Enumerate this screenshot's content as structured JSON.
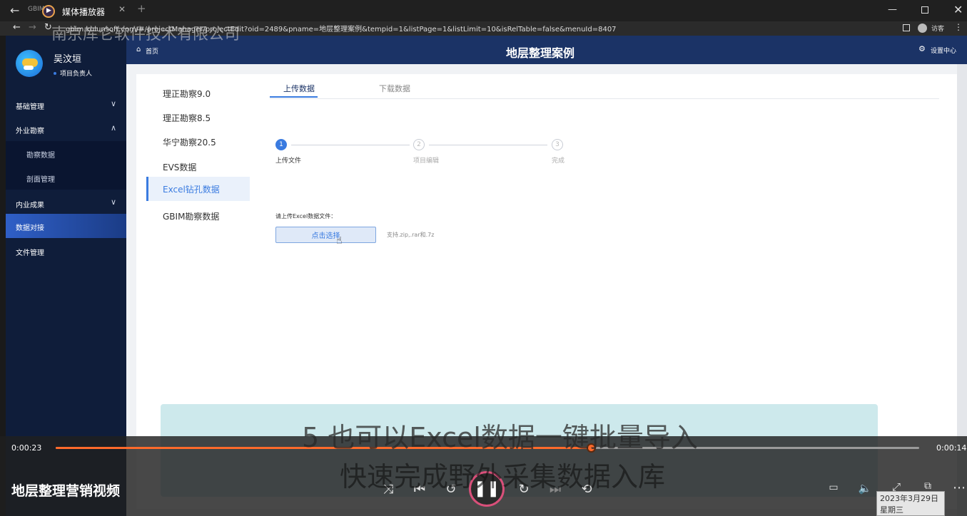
{
  "player": {
    "tab_title": "GBIM",
    "app_title": "媒体播放器",
    "time_current": "0:00:23",
    "time_remaining": "0:00:14",
    "progress": 0.62,
    "video_title": "地层整理营销视频"
  },
  "browser": {
    "url": "gbim.kulunsoft.com/#/projectManager/projectEdit?oid=2489&pname=地层整理案例&tempid=1&listPage=1&listLimit=10&isRelTable=false&menuId=8407",
    "user_label": "访客"
  },
  "watermark": "南京库仑软件技术有限公司",
  "user": {
    "name": "吴汶垣",
    "role": "项目负责人"
  },
  "sidebar": {
    "items": [
      {
        "label": "基础管理",
        "chevron": "∨"
      },
      {
        "label": "外业勘察",
        "chevron": "∧"
      },
      {
        "label": "勘察数据"
      },
      {
        "label": "剖面管理"
      },
      {
        "label": "内业成果",
        "chevron": "∨"
      },
      {
        "label": "数据对接"
      },
      {
        "label": "文件管理"
      }
    ]
  },
  "header": {
    "home": "首页",
    "title": "地层整理案例",
    "settings": "设置中心"
  },
  "leftnav": {
    "items": [
      "理正勘察9.0",
      "理正勘察8.5",
      "华宁勘察20.5",
      "EVS数据",
      "Excel钻孔数据",
      "GBIM勘察数据"
    ]
  },
  "tabs": [
    "上传数据",
    "下载数据"
  ],
  "steps": [
    {
      "num": "1",
      "label": "上传文件"
    },
    {
      "num": "2",
      "label": "项目编辑"
    },
    {
      "num": "3",
      "label": "完成"
    }
  ],
  "upload": {
    "prompt": "请上传Excel数据文件：",
    "button": "点击选择",
    "hint": "支持.zip,.rar和.7z"
  },
  "subtitles": {
    "line1": "5 也可以Excel数据一键批量导入",
    "line2": "快速完成野外采集数据入库"
  },
  "datetime": {
    "date": "2023年3月29日",
    "weekday": "星期三"
  },
  "colors": {
    "accent": "#3a7be0",
    "progress": "#ff6a2b",
    "topbar": "#1b3366",
    "sidebar": "#0f1d3a"
  }
}
